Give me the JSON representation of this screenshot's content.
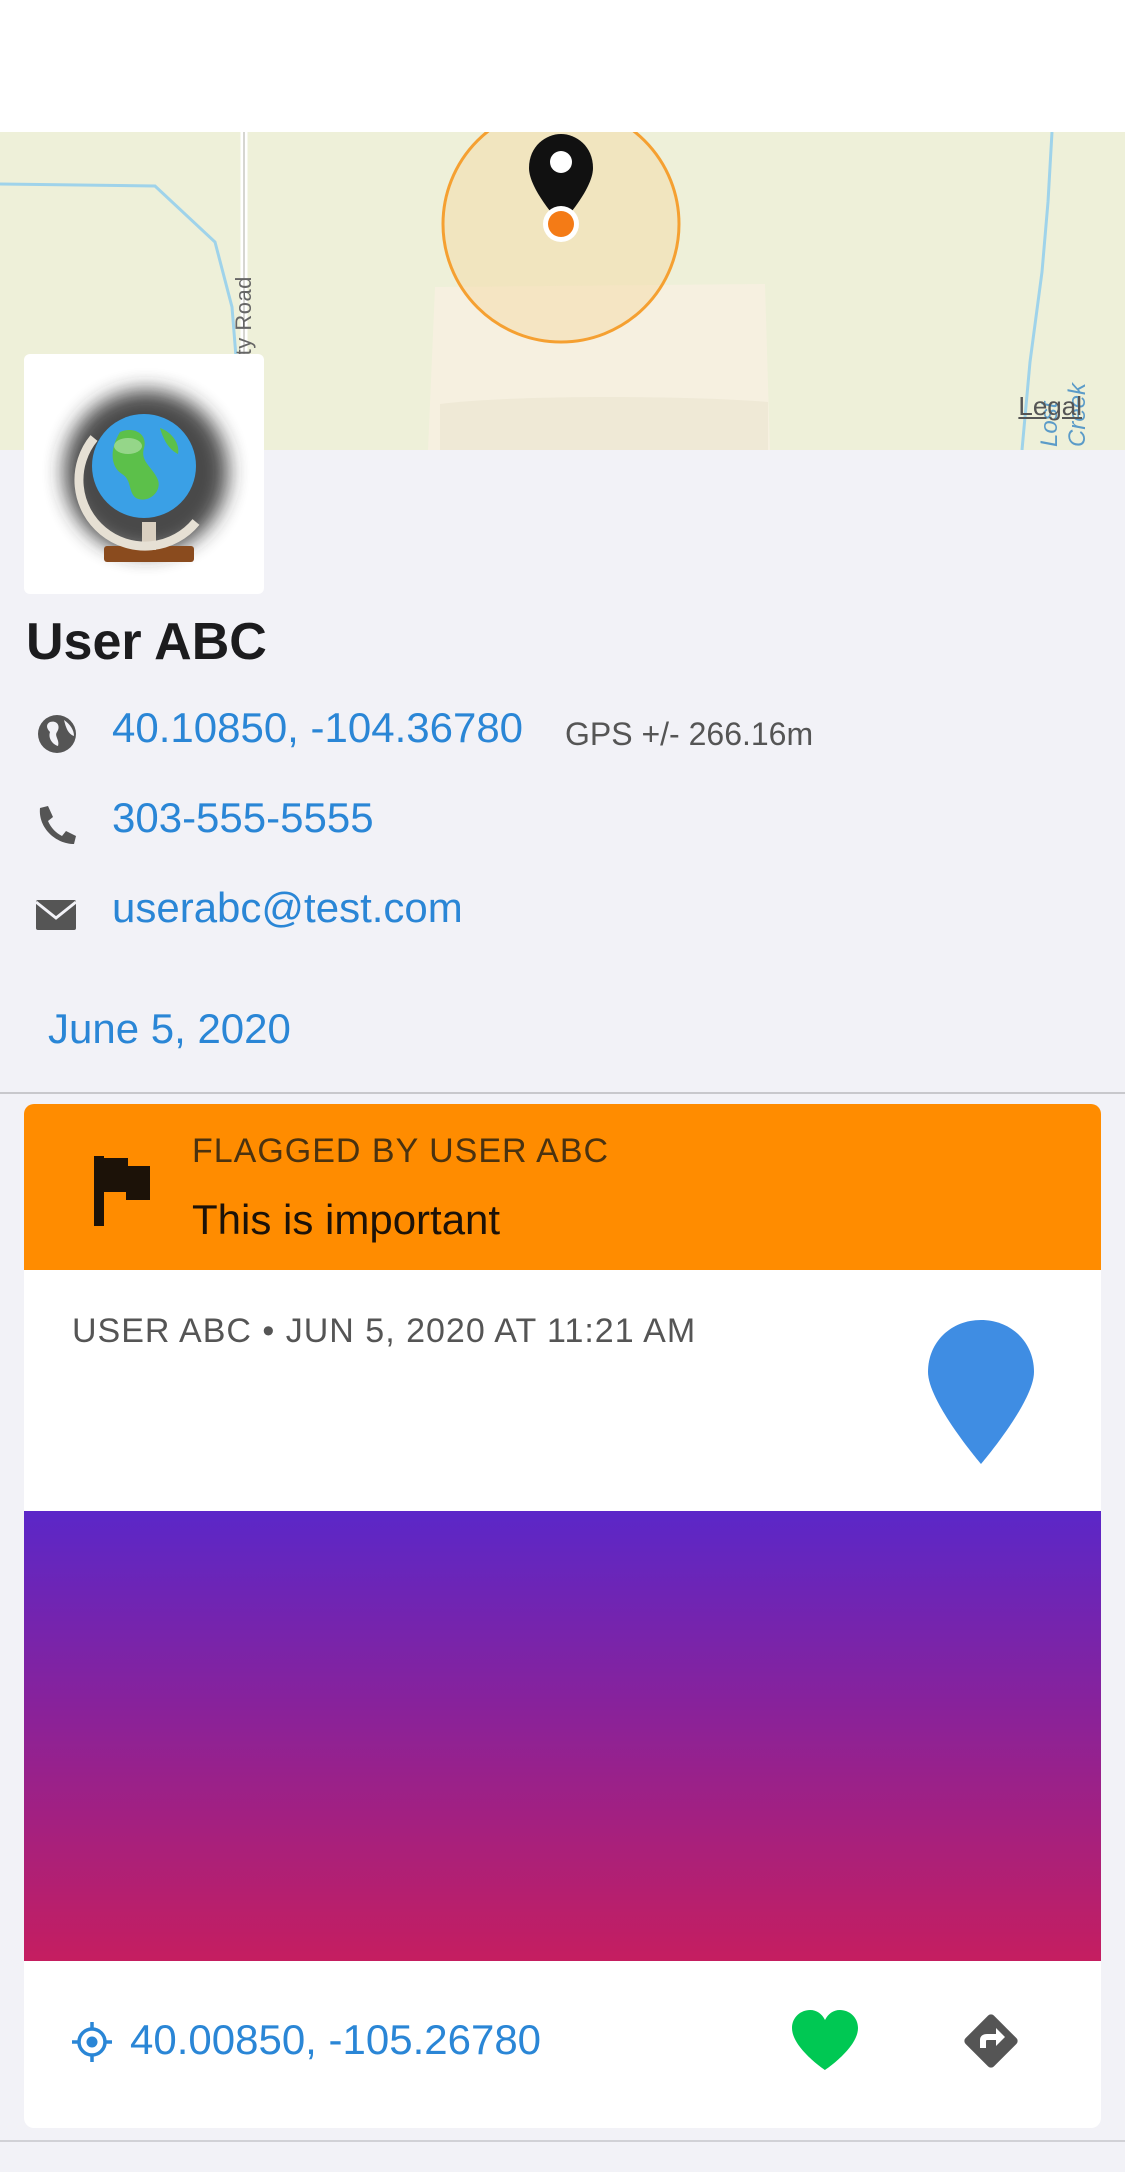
{
  "map": {
    "legal_label": "Legal",
    "road_label": "County Road",
    "creek_label": "Lost Creek",
    "icons": [
      "map-marker-icon",
      "location-dot-icon"
    ],
    "accuracy_ring_color": "#f5a031",
    "location_dot_color": "#f47b16"
  },
  "user": {
    "name": "User ABC",
    "avatar_icon": "globe-icon",
    "coordinates": "40.10850, -104.36780",
    "gps_accuracy": "GPS +/- 266.16m",
    "phone": "303-555-5555",
    "email": "userabc@test.com",
    "date": "June 5, 2020",
    "icons": [
      "globe-icon",
      "phone-icon",
      "email-icon"
    ]
  },
  "flag": {
    "title": "FLAGGED BY USER ABC",
    "text": "This is important",
    "icon": "flag-icon",
    "background_color": "#ff8c00"
  },
  "observation": {
    "header": "USER ABC • JUN 5, 2020 AT 11:21 AM",
    "pin_icon": "map-pin-icon",
    "pin_color": "#3f8de3",
    "location": "40.00850, -105.26780",
    "location_icon": "crosshairs-icon",
    "favorite_icon": "heart-icon",
    "favorite_color": "#00c853",
    "directions_icon": "directions-icon"
  },
  "colors": {
    "link": "#2a86d6",
    "background": "#f2f2f7"
  }
}
